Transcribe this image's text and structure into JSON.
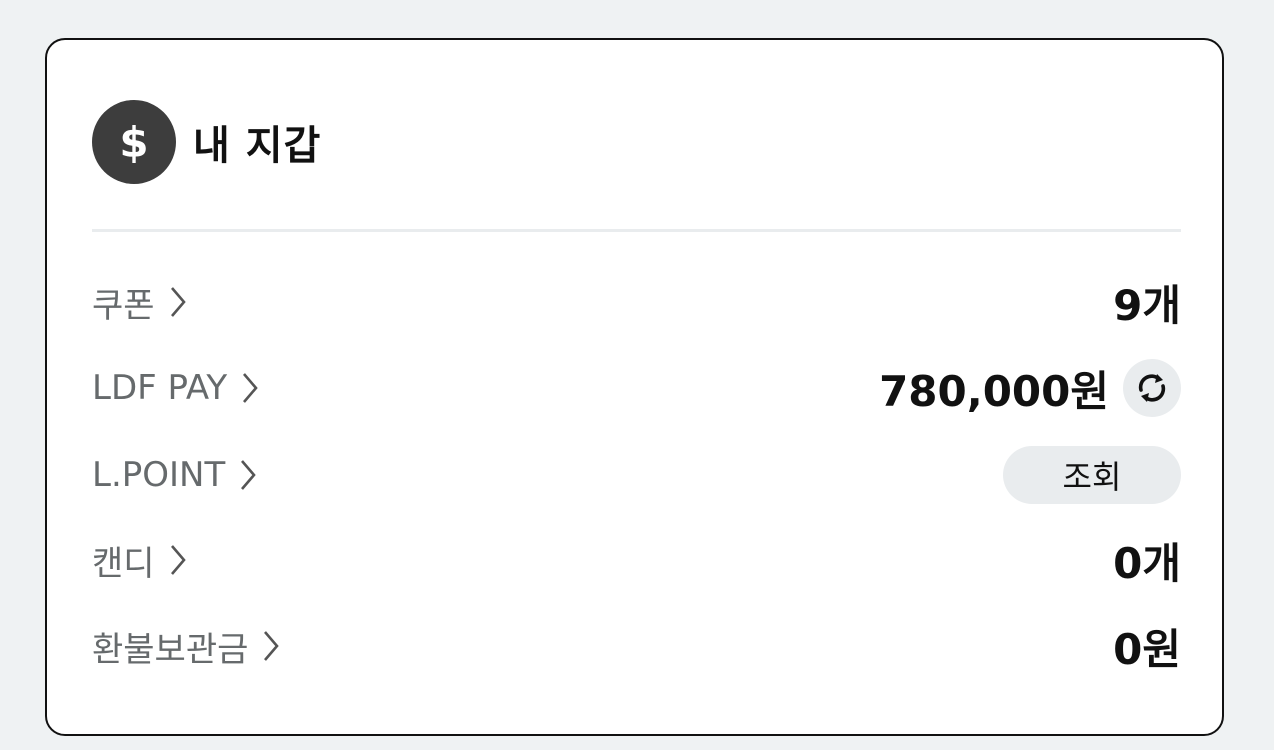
{
  "wallet": {
    "icon": "dollar-coin-icon",
    "icon_symbol": "$",
    "title": "내 지갑"
  },
  "rows": [
    {
      "label": "쿠폰",
      "value": "9개"
    },
    {
      "label": "LDF PAY",
      "value": "780,000원",
      "action_icon": "refresh-icon"
    },
    {
      "label": "L.POINT",
      "button_label": "조회"
    },
    {
      "label": "캔디",
      "value": "0개"
    },
    {
      "label": "환불보관금",
      "value": "0원"
    }
  ],
  "colors": {
    "background": "#eff2f3",
    "card": "#ffffff",
    "border": "#111111",
    "label_text": "#666a6c",
    "value_text": "#111111",
    "chip_bg": "#e9ecee",
    "coin_bg": "#3d3d3d"
  }
}
